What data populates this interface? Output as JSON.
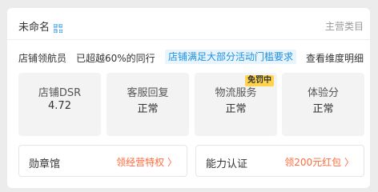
{
  "header": {
    "store_name": "未命名",
    "main_category": "主营类目"
  },
  "navigator": {
    "title": "店铺领航员",
    "beat_text": "已超越60%的同行",
    "activity_tag": "店铺满足大部分活动门槛要求",
    "view_link": "查看维度明细"
  },
  "metrics": [
    {
      "label": "店铺DSR",
      "value": "4.72"
    },
    {
      "label": "客服回复",
      "value": "正常"
    },
    {
      "label": "物流服务",
      "value": "正常",
      "badge": "免罚中"
    },
    {
      "label": "体验分",
      "value": "正常"
    }
  ],
  "links": [
    {
      "title": "勋章馆",
      "action": "领经营特权 〉"
    },
    {
      "title": "能力认证",
      "action": "领200元红包 〉"
    }
  ],
  "colors": {
    "accent_blue": "#1d8fe0",
    "accent_orange": "#ff6a3d",
    "badge_yellow": "#ffd34d"
  }
}
